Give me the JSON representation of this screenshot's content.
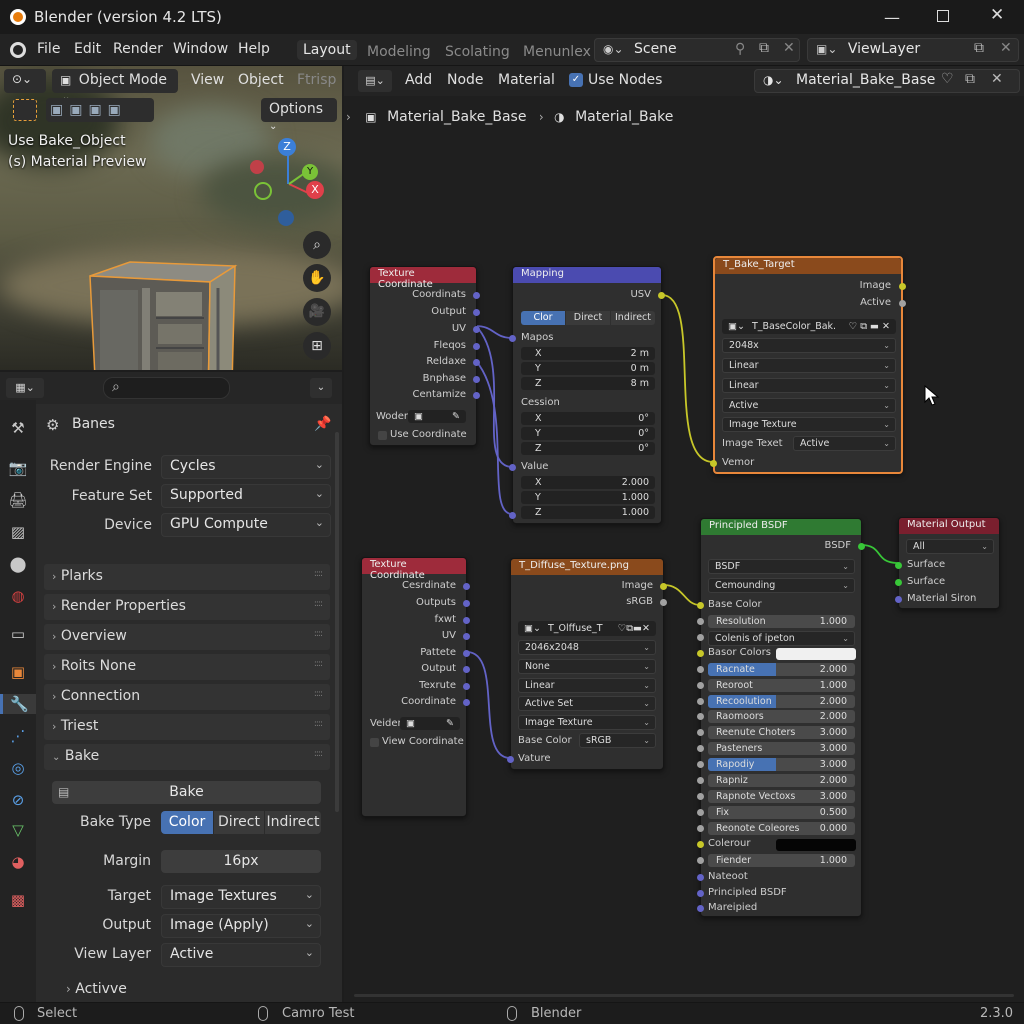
{
  "window": {
    "title": "Blender (version 4.2 LTS)"
  },
  "menubar": {
    "items": [
      "File",
      "Edit",
      "Render",
      "Window",
      "Help"
    ],
    "workspaces": [
      "Layout",
      "Modeling",
      "Scolating",
      "Menunlex"
    ],
    "scene": "Scene",
    "view_layer": "ViewLayer"
  },
  "viewport": {
    "mode": "Object Mode",
    "menus": [
      "View",
      "Object",
      "Ftrisp"
    ],
    "options": "Options",
    "overlay_line1": "Use Bake_Object",
    "overlay_line2": "(s) Material Preview",
    "gizmo": {
      "z": "Z",
      "y": "Y",
      "x": "X"
    }
  },
  "properties": {
    "search_placeholder": "",
    "context": "Banes",
    "rows": [
      {
        "label": "Render Engine",
        "value": "Cycles"
      },
      {
        "label": "Feature Set",
        "value": "Supported"
      },
      {
        "label": "Device",
        "value": "GPU Compute"
      }
    ],
    "panels": [
      "Plarks",
      "Render Properties",
      "Overview",
      "Roits None",
      "Connection",
      "Triest"
    ],
    "bake": {
      "title": "Bake",
      "button": "Bake",
      "type_label": "Bake Type",
      "type_options": [
        "Color",
        "Direct",
        "Indirect"
      ],
      "margin_label": "Margin",
      "margin_value": "16px",
      "target_label": "Target",
      "target_value": "Image Textures",
      "output_label": "Output",
      "output_value": "Image (Apply)",
      "view_layer_label": "View Layer",
      "view_layer_value": "Active",
      "sub_panel": "Activve"
    }
  },
  "node_header": {
    "menus": [
      "Add",
      "Node",
      "Material"
    ],
    "use_nodes": "Use Nodes",
    "material": "Material_Bake_Base",
    "breadcrumb": [
      "Material_Bake_Base",
      "Material_Bake"
    ]
  },
  "nodes": {
    "texcoord1": {
      "title": "Texture Coordinate",
      "outputs": [
        "Coordinats",
        "Output",
        "UV",
        "Fleqos",
        "Reldaxe",
        "Bnphase",
        "Centamize"
      ],
      "field_label": "Woder",
      "checkbox": "Use Coordinate"
    },
    "mapping": {
      "title": "Mapping",
      "output": "USV",
      "tabs": [
        "Clor",
        "Direct",
        "Indirect"
      ],
      "groups": [
        {
          "name": "Mapos",
          "vals": [
            [
              "X",
              "2 m"
            ],
            [
              "Y",
              "0 m"
            ],
            [
              "Z",
              "8 m"
            ]
          ]
        },
        {
          "name": "Cession",
          "vals": [
            [
              "X",
              "0°"
            ],
            [
              "Y",
              "0°"
            ],
            [
              "Z",
              "0°"
            ]
          ]
        },
        {
          "name": "Value",
          "vals": [
            [
              "X",
              "2.000"
            ],
            [
              "Y",
              "1.000"
            ],
            [
              "Z",
              "1.000"
            ]
          ]
        }
      ]
    },
    "bake_target": {
      "title": "T_Bake_Target",
      "outputs": [
        "Image",
        "Active"
      ],
      "image": "T_BaseColor_Bak.",
      "drops": [
        "2048x",
        "Linear",
        "Linear",
        "Active",
        "Image Texture"
      ],
      "image_texet_label": "Image Texet",
      "image_texet_value": "Active",
      "input": "Vemor"
    },
    "texcoord2": {
      "title": "Texture Coordinate",
      "outputs": [
        "Cesrdinate",
        "Outputs",
        "fxwt",
        "UV",
        "Pattete",
        "Output",
        "Texrute",
        "Coordinate"
      ],
      "field_label": "Veider",
      "checkbox": "View Coordinate"
    },
    "diffuse": {
      "title": "T_Diffuse_Texture.png",
      "outputs": [
        "Image",
        "sRGB"
      ],
      "image": "T_Olffuse_T",
      "drops": [
        "2046x2048",
        "None",
        "Linear",
        "Active Set",
        "Image Texture"
      ],
      "base_label": "Base Color",
      "base_value": "sRGB",
      "input": "Vature"
    },
    "bsdf": {
      "title": "Principled BSDF",
      "output": "BSDF",
      "drops": [
        "BSDF",
        "Cemounding"
      ],
      "base_color": "Base Color",
      "sliders": [
        {
          "label": "Resolution",
          "value": "1.000",
          "fill": 0
        },
        {
          "label": "Colenis of ipeton",
          "value": "",
          "fill": 0,
          "drop": true
        },
        {
          "label": "Basor Colors",
          "value": "",
          "fill": 0,
          "color": "#f0f0f0"
        },
        {
          "label": "Racnate",
          "value": "2.000",
          "fill": 0.46
        },
        {
          "label": "Reoroot",
          "value": "1.000",
          "fill": 0
        },
        {
          "label": "Recoolution",
          "value": "2.000",
          "fill": 0.46
        },
        {
          "label": "Raomoors",
          "value": "2.000",
          "fill": 0
        },
        {
          "label": "Reenute Choters",
          "value": "3.000",
          "fill": 0
        },
        {
          "label": "Pasteners",
          "value": "3.000",
          "fill": 0
        },
        {
          "label": "Rapodiy",
          "value": "3.000",
          "fill": 0.46
        },
        {
          "label": "Rapniz",
          "value": "2.000",
          "fill": 0
        },
        {
          "label": "Rapnote Vectoxs",
          "value": "3.000",
          "fill": 0
        },
        {
          "label": "Fix",
          "value": "0.500",
          "fill": 0
        },
        {
          "label": "Reonote Coleores",
          "value": "0.000",
          "fill": 0
        },
        {
          "label": "Colerour",
          "value": "",
          "fill": 0,
          "color": "#050505"
        },
        {
          "label": "Fiender",
          "value": "1.000",
          "fill": 0
        }
      ],
      "inputs": [
        "Nateoot",
        "Principled BSDF",
        "Mareipied"
      ]
    },
    "output": {
      "title": "Material Output",
      "drop": "All",
      "inputs": [
        "Surface",
        "Surface",
        "Material Siron"
      ]
    }
  },
  "status": {
    "left": "Select",
    "middle": "Camro Test",
    "app": "Blender",
    "version": "2.3.0"
  },
  "colors": {
    "accent": "#4772b3",
    "selected_node": "#e8873a",
    "socket_yellow": "#c7c729",
    "socket_purple": "#6363c7",
    "socket_green": "#38c738",
    "socket_grey": "#a1a1a1"
  }
}
